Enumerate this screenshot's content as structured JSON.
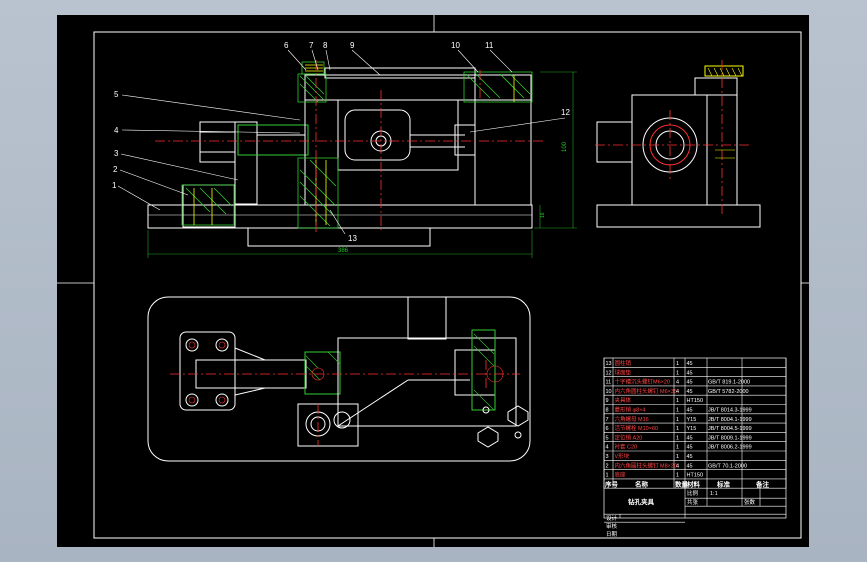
{
  "drawing": {
    "colors": {
      "background": "#000000",
      "frame": "#ffffff",
      "outline": "#ffffff",
      "centerline": "#ff3030",
      "section": "#33cc33",
      "dimension": "#22aa22",
      "threads": "#ffff00",
      "window_chrome": "#b9c3cf"
    },
    "part_labels": [
      "1",
      "2",
      "3",
      "4",
      "5",
      "6",
      "7",
      "8",
      "9",
      "10",
      "11",
      "12",
      "13"
    ],
    "dimension_texts": {
      "width": "386",
      "height": "100",
      "small_height": "16"
    }
  },
  "parts_list": {
    "rows": [
      {
        "no": "13",
        "name": "圆柱销",
        "qty": "1",
        "material": "45",
        "standard": ""
      },
      {
        "no": "12",
        "name": "球面垫",
        "qty": "1",
        "material": "45",
        "standard": ""
      },
      {
        "no": "11",
        "name": "十字槽沉头螺钉M6×20",
        "qty": "4",
        "material": "45",
        "standard": "GB/T 819.1-2000"
      },
      {
        "no": "10",
        "name": "内六角圆柱头螺钉 M6×35",
        "qty": "4",
        "material": "45",
        "standard": "GB/T 5782-2000"
      },
      {
        "no": "9",
        "name": "夹具体",
        "qty": "1",
        "material": "HT150",
        "standard": ""
      },
      {
        "no": "8",
        "name": "菱形销 φ8×4",
        "qty": "1",
        "material": "45",
        "standard": "JB/T 8014.3-1999"
      },
      {
        "no": "7",
        "name": "六角螺母 M16",
        "qty": "1",
        "material": "Y15",
        "standard": "JB/T 8004.1-1999"
      },
      {
        "no": "6",
        "name": "活节螺栓 M10×60",
        "qty": "1",
        "material": "Y15",
        "standard": "JB/T 8004.5-1999"
      },
      {
        "no": "5",
        "name": "定位销 A20",
        "qty": "1",
        "material": "45",
        "standard": "JB/T 8009.1-1999"
      },
      {
        "no": "4",
        "name": "衬套 C20",
        "qty": "1",
        "material": "45",
        "standard": "JB/T 8006.2-1999"
      },
      {
        "no": "3",
        "name": "V形块",
        "qty": "1",
        "material": "45",
        "standard": ""
      },
      {
        "no": "2",
        "name": "内六角圆柱头螺钉 M8×20",
        "qty": "4",
        "material": "45",
        "standard": "GB/T 70.1-2000"
      },
      {
        "no": "1",
        "name": "底座",
        "qty": "1",
        "material": "HT150",
        "standard": ""
      }
    ],
    "header": {
      "no": "序号",
      "name": "名称",
      "qty": "数量",
      "material": "材料",
      "standard": "标准",
      "note": "备注"
    },
    "title_block": {
      "drawing_name": "钻孔夹具",
      "scale_label": "比例",
      "scale_value": "1:1",
      "sheet_label": "张数",
      "design_label": "设计",
      "check_label": "审核",
      "date_label": "日期",
      "qty_label": "共张"
    }
  }
}
